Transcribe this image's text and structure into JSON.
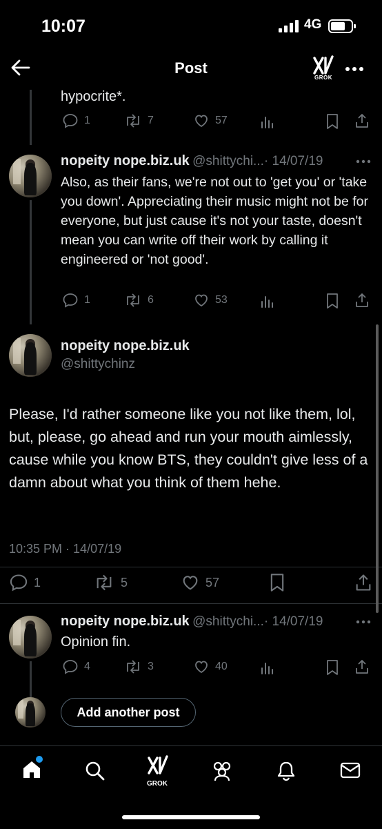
{
  "status_bar": {
    "time": "10:07",
    "network": "4G"
  },
  "header": {
    "title": "Post",
    "grok_label": "GROK"
  },
  "posts": [
    {
      "body": "hypocrite*.",
      "stats": {
        "replies": "1",
        "reposts": "7",
        "likes": "57"
      }
    },
    {
      "name": "nopeity nope.biz.uk",
      "handle": "@shittychi...",
      "date": "· 14/07/19",
      "body": "Also, as their fans, we're not out to 'get you' or 'take you down'. Appreciating their music might not be for everyone, but just cause it's not your taste, doesn't mean you can write off their work by calling it engineered or 'not good'.",
      "stats": {
        "replies": "1",
        "reposts": "6",
        "likes": "53"
      }
    }
  ],
  "main_post": {
    "name": "nopeity nope.biz.uk",
    "handle": "@shittychinz",
    "body": "Please, I'd rather someone like you not like them, lol, but, please, go ahead and run your mouth aimlessly, cause while you know BTS, they couldn't give less of a damn about what you think of them hehe.",
    "timestamp": "10:35 PM · 14/07/19",
    "stats": {
      "replies": "1",
      "reposts": "5",
      "likes": "57"
    }
  },
  "reply": {
    "name": "nopeity nope.biz.uk",
    "handle": "@shittychi...",
    "date": "· 14/07/19",
    "body": "Opinion fin.",
    "stats": {
      "replies": "4",
      "reposts": "3",
      "likes": "40"
    }
  },
  "composer": {
    "button_label": "Add another post"
  },
  "tab_bar": {
    "grok_label": "GROK"
  },
  "colors": {
    "background": "#000000",
    "text": "#e7e9ea",
    "muted": "#71767b",
    "accent": "#1d9bf0"
  }
}
